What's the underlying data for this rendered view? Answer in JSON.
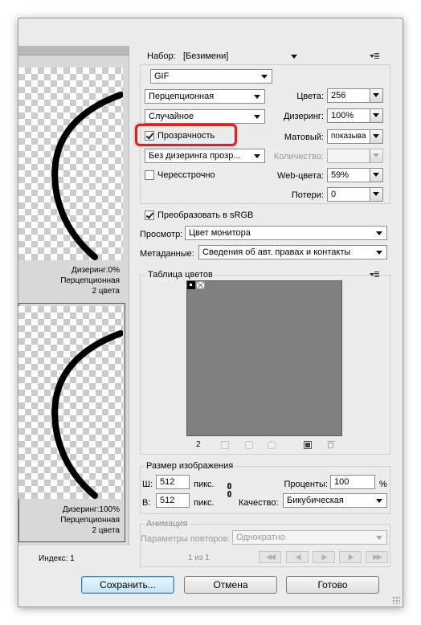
{
  "preset": {
    "label": "Набор:",
    "value": "[Безимени]",
    "menu_icon": "flyout-menu-icon"
  },
  "format": {
    "value": "GIF"
  },
  "reduction": {
    "value": "Перцепционная"
  },
  "colors": {
    "label": "Цвета:",
    "value": "256"
  },
  "dither_algo": {
    "value": "Случайное"
  },
  "dither": {
    "label": "Дизеринг:",
    "value": "100%"
  },
  "transparency": {
    "label": "Прозрачность",
    "checked": true,
    "highlight_color": "#e02020"
  },
  "matte": {
    "label": "Матовый:",
    "value": "показыва"
  },
  "transparency_dither": {
    "value": "Без дизеринга прозр..."
  },
  "amount": {
    "label": "Количество:",
    "value": ""
  },
  "interlaced": {
    "label": "Чересстрочно",
    "checked": false
  },
  "web_snap": {
    "label": "Web-цвета:",
    "value": "59%"
  },
  "lossy": {
    "label": "Потери:",
    "value": "0"
  },
  "convert_srgb": {
    "label": "Преобразовать в sRGB",
    "checked": true
  },
  "preview": {
    "label": "Просмотр:",
    "value": "Цвет монитора"
  },
  "metadata": {
    "label": "Метаданные:",
    "value": "Сведения об авт. правах и контакты"
  },
  "color_table": {
    "title": "Таблица цветов",
    "count": "2",
    "swatch_bg": "#808080"
  },
  "image_size": {
    "title": "Размер изображения",
    "width_label": "Ш:",
    "width_value": "512",
    "width_unit": "пикс.",
    "height_label": "В:",
    "height_value": "512",
    "height_unit": "пикс.",
    "percent_label": "Проценты:",
    "percent_value": "100",
    "percent_unit": "%",
    "quality_label": "Качество:",
    "quality_value": "Бикубическая"
  },
  "animation": {
    "title": "Анимация",
    "loop_label": "Параметры повторов:",
    "loop_value": "Однократно",
    "frame_counter": "1 из 1"
  },
  "previews": [
    {
      "dither": "Дизеринг:0%",
      "method": "Перцепционная",
      "colors": "2 цвета"
    },
    {
      "dither": "Дизеринг:100%",
      "method": "Перцепционная",
      "colors": "2 цвета"
    }
  ],
  "index_label": "Индекс: 1",
  "buttons": {
    "save": "Сохранить...",
    "cancel": "Отмена",
    "done": "Готово"
  }
}
